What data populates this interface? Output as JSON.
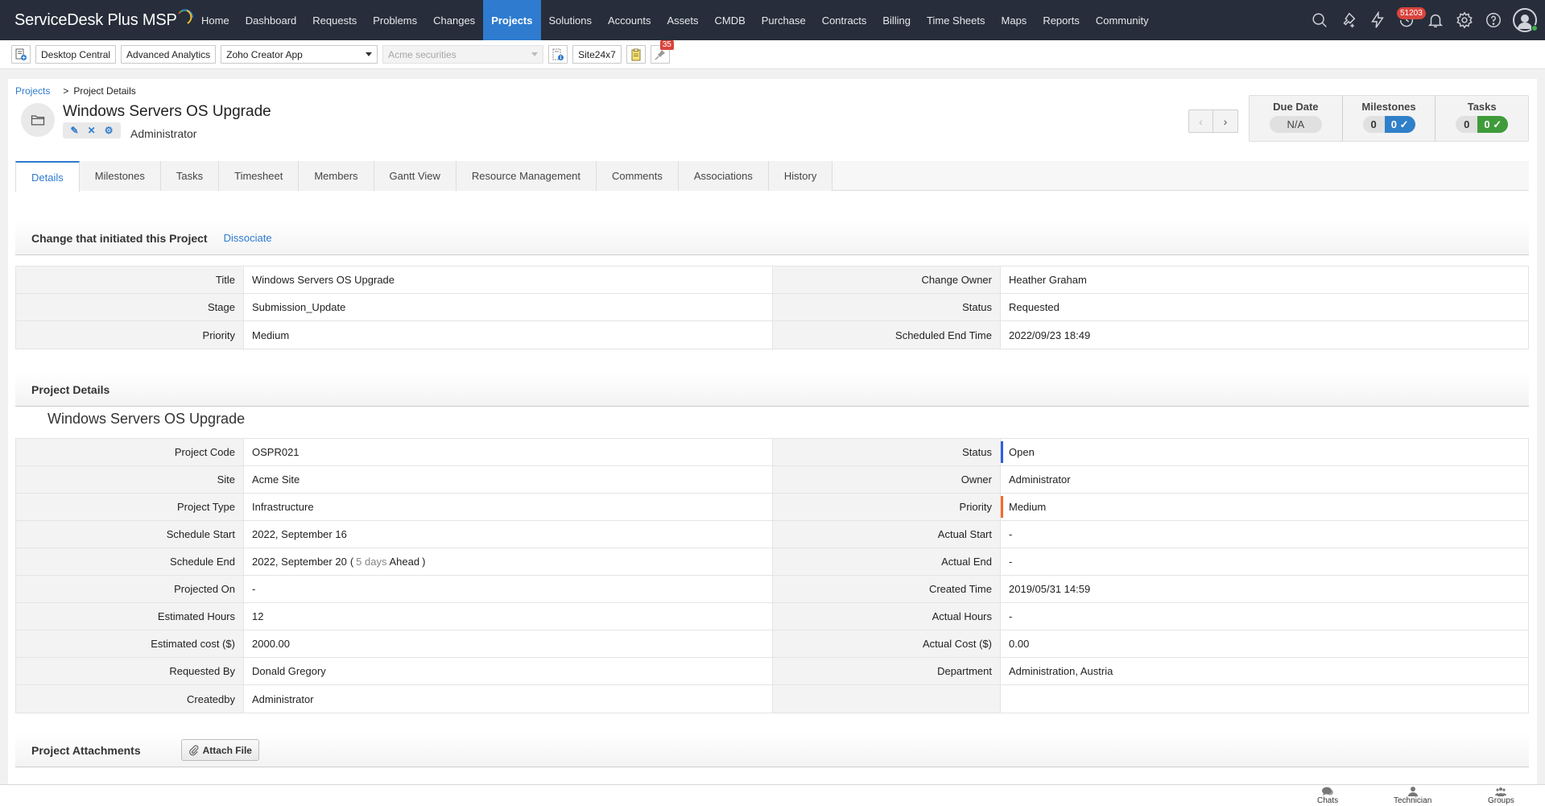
{
  "app": {
    "brand": "ServiceDesk Plus MSP"
  },
  "nav": {
    "items": [
      {
        "label": "Home",
        "active": false
      },
      {
        "label": "Dashboard",
        "active": false
      },
      {
        "label": "Requests",
        "active": false
      },
      {
        "label": "Problems",
        "active": false
      },
      {
        "label": "Changes",
        "active": false
      },
      {
        "label": "Projects",
        "active": true
      },
      {
        "label": "Solutions",
        "active": false
      },
      {
        "label": "Accounts",
        "active": false
      },
      {
        "label": "Assets",
        "active": false
      },
      {
        "label": "CMDB",
        "active": false
      },
      {
        "label": "Purchase",
        "active": false
      },
      {
        "label": "Contracts",
        "active": false
      },
      {
        "label": "Billing",
        "active": false
      },
      {
        "label": "Time Sheets",
        "active": false
      },
      {
        "label": "Maps",
        "active": false
      },
      {
        "label": "Reports",
        "active": false
      },
      {
        "label": "Community",
        "active": false
      }
    ],
    "icons": [
      "search-icon",
      "quick-create-icon",
      "lightning-icon",
      "history-icon",
      "bell-icon",
      "gear-icon",
      "help-icon",
      "user-avatar"
    ],
    "notification_count": "51203",
    "accent_color": "#2e7bcf"
  },
  "toolbar": {
    "desktop_central": "Desktop Central",
    "advanced_analytics": "Advanced Analytics",
    "zoho_creator": "Zoho Creator App",
    "account_select": "Acme securities",
    "site24x7": "Site24x7",
    "reminder_count": "35"
  },
  "breadcrumb": {
    "root": "Projects",
    "separator": ">",
    "current": "Project Details"
  },
  "project": {
    "title": "Windows Servers OS Upgrade",
    "owner": "Administrator"
  },
  "summary": {
    "due_date_label": "Due Date",
    "due_date_value": "N/A",
    "milestones_label": "Milestones",
    "milestones_open": "0",
    "milestones_done": "0",
    "tasks_label": "Tasks",
    "tasks_open": "0",
    "tasks_done": "0"
  },
  "tabs": [
    {
      "label": "Details",
      "active": true
    },
    {
      "label": "Milestones",
      "active": false
    },
    {
      "label": "Tasks",
      "active": false
    },
    {
      "label": "Timesheet",
      "active": false
    },
    {
      "label": "Members",
      "active": false
    },
    {
      "label": "Gantt View",
      "active": false
    },
    {
      "label": "Resource Management",
      "active": false
    },
    {
      "label": "Comments",
      "active": false
    },
    {
      "label": "Associations",
      "active": false
    },
    {
      "label": "History",
      "active": false
    }
  ],
  "change_section": {
    "title": "Change that initiated this Project",
    "dissociate": "Dissociate",
    "rows": [
      {
        "l1": "Title",
        "v1": "Windows Servers OS Upgrade",
        "l2": "Change Owner",
        "v2": "Heather Graham"
      },
      {
        "l1": "Stage",
        "v1": "Submission_Update",
        "l2": "Status",
        "v2": "Requested"
      },
      {
        "l1": "Priority",
        "v1": "Medium",
        "l2": "Scheduled End Time",
        "v2": "2022/09/23 18:49"
      }
    ]
  },
  "details_section": {
    "title": "Project Details",
    "project_name": "Windows Servers OS Upgrade",
    "rows": [
      {
        "l1": "Project Code",
        "v1": "OSPR021",
        "l2": "Status",
        "v2": "Open",
        "marker2": "#2f5fe0"
      },
      {
        "l1": "Site",
        "v1": "Acme Site",
        "l2": "Owner",
        "v2": "Administrator"
      },
      {
        "l1": "Project Type",
        "v1": "Infrastructure",
        "l2": "Priority",
        "v2": "Medium",
        "marker2": "#f26b2a"
      },
      {
        "l1": "Schedule Start",
        "v1": "2022, September 16",
        "l2": "Actual Start",
        "v2": "-"
      },
      {
        "l1": "Schedule End",
        "v1": "2022, September 20",
        "l2": "Actual End",
        "v2": "-"
      },
      {
        "l1": "Projected On",
        "v1": "-",
        "l2": "Created Time",
        "v2": "2019/05/31 14:59"
      },
      {
        "l1": "Estimated Hours",
        "v1": "12",
        "l2": "Actual Hours",
        "v2": "-"
      },
      {
        "l1": "Estimated cost ($)",
        "v1": "2000.00",
        "l2": "Actual Cost ($)",
        "v2": "0.00"
      },
      {
        "l1": "Requested By",
        "v1": "Donald Gregory",
        "l2": "Department",
        "v2": "Administration, Austria"
      },
      {
        "l1": "Createdby",
        "v1": "Administrator",
        "l2": "",
        "v2": ""
      }
    ],
    "schedule_end_suffix": {
      "open": "(",
      "days": "5 days",
      "status": "Ahead",
      "close": ")"
    }
  },
  "attachments": {
    "title": "Project Attachments",
    "attach_button": "Attach File"
  },
  "bottom_bar": {
    "chats": "Chats",
    "technician": "Technician",
    "groups": "Groups"
  }
}
